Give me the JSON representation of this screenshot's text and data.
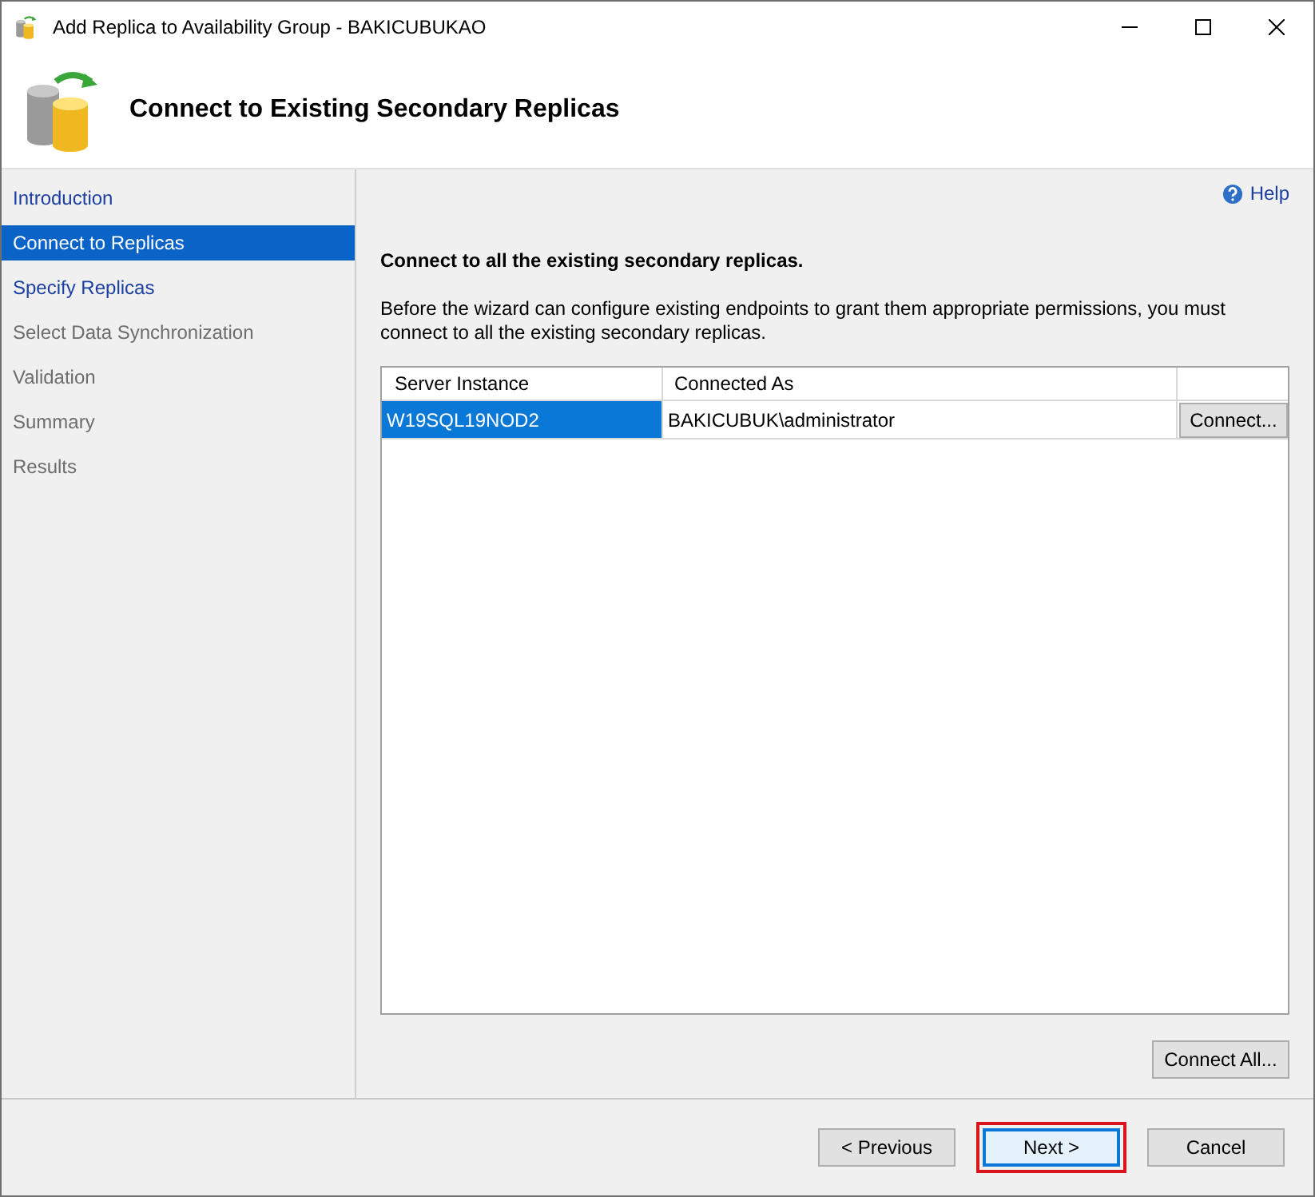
{
  "window": {
    "title": "Add Replica to Availability Group - BAKICUBUKAO"
  },
  "header": {
    "title": "Connect to Existing Secondary Replicas"
  },
  "sidebar": {
    "items": [
      {
        "label": "Introduction",
        "selected": false,
        "enabled": true
      },
      {
        "label": "Connect to Replicas",
        "selected": true,
        "enabled": true
      },
      {
        "label": "Specify Replicas",
        "selected": false,
        "enabled": true
      },
      {
        "label": "Select Data Synchronization",
        "selected": false,
        "enabled": false
      },
      {
        "label": "Validation",
        "selected": false,
        "enabled": false
      },
      {
        "label": "Summary",
        "selected": false,
        "enabled": false
      },
      {
        "label": "Results",
        "selected": false,
        "enabled": false
      }
    ]
  },
  "help": "Help",
  "heading": "Connect to all the existing secondary replicas.",
  "description": "Before the wizard can configure existing endpoints to grant them appropriate permissions, you must connect to all the existing secondary replicas.",
  "table": {
    "columns": [
      "Server Instance",
      "Connected As"
    ],
    "rows": [
      {
        "server_instance": "W19SQL19NOD2",
        "connected_as": "BAKICUBUK\\administrator",
        "action": "Connect...",
        "selected": true
      }
    ]
  },
  "connect_all": "Connect All...",
  "buttons": [
    {
      "label": "< Previous",
      "focused": false,
      "highlighted": false
    },
    {
      "label": "Next >",
      "focused": true,
      "highlighted": true
    },
    {
      "label": "Cancel",
      "focused": false,
      "highlighted": false
    }
  ]
}
